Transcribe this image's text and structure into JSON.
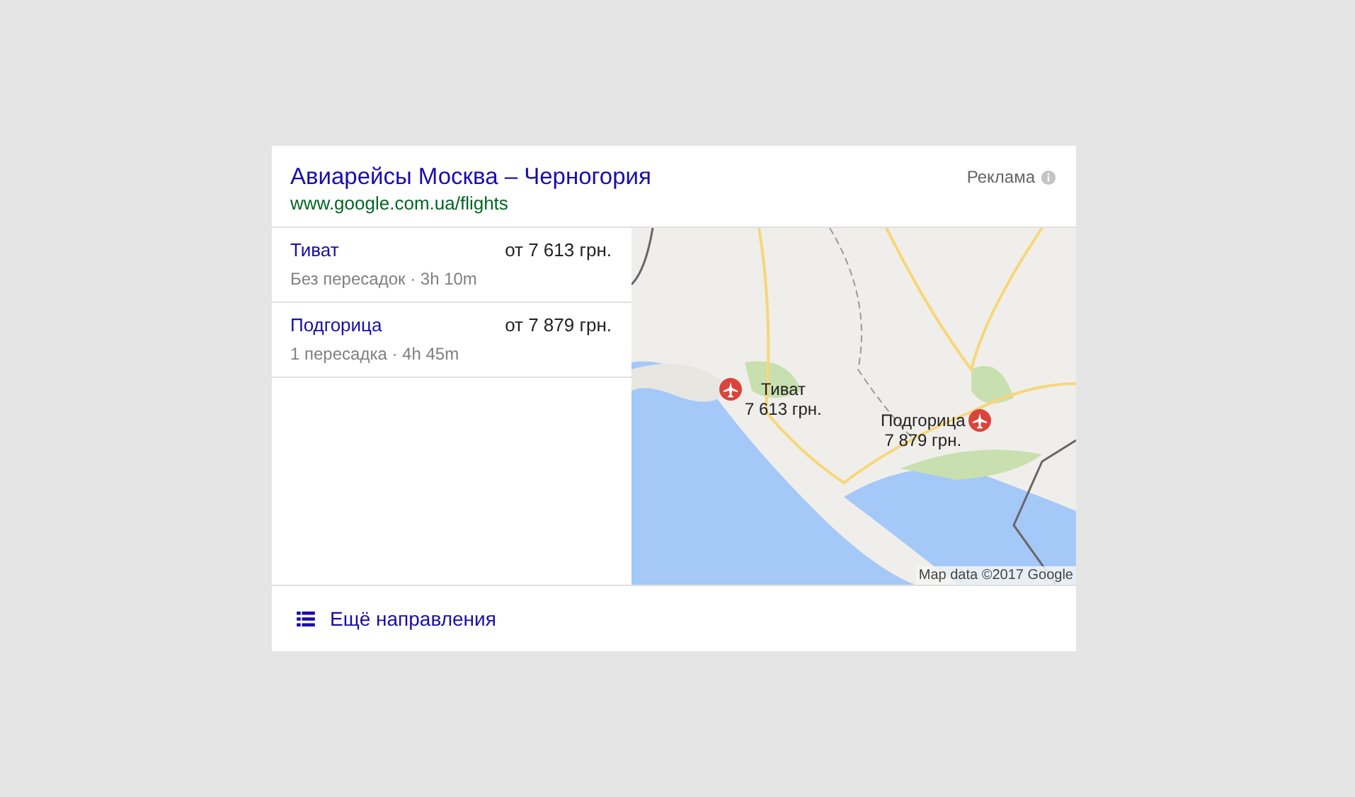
{
  "ad": {
    "title": "Авиарейсы Москва – Черногория",
    "url": "www.google.com.ua/flights",
    "ad_label": "Реклама"
  },
  "flights": [
    {
      "city": "Тиват",
      "price": "от 7 613 грн.",
      "details": "Без пересадок · 3h 10m"
    },
    {
      "city": "Подгорица",
      "price": "от 7 879 грн.",
      "details": "1 пересадка · 4h 45m"
    }
  ],
  "map": {
    "kind": "picture",
    "markers": [
      {
        "name": "Тиват",
        "price": "7 613 грн."
      },
      {
        "name": "Подгорица",
        "price": "7 879 грн."
      }
    ],
    "attribution": "Map data ©2017 Google"
  },
  "more_link": "Ещё направления"
}
